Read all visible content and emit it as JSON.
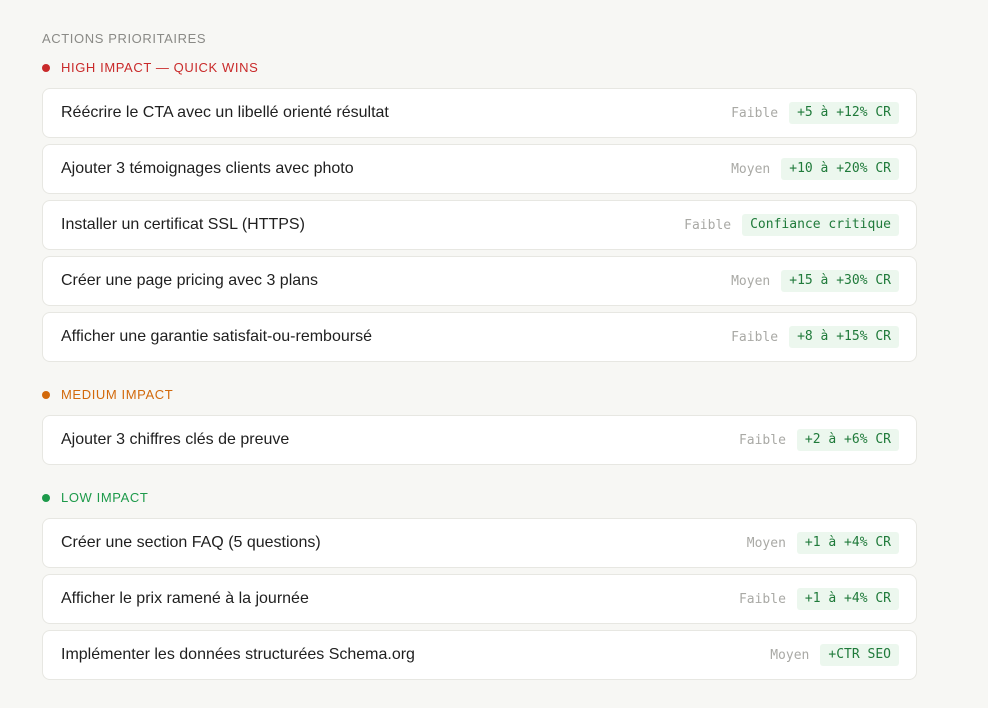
{
  "page": {
    "title": "ACTIONS PRIORITAIRES"
  },
  "colors": {
    "high": "#c92a2a",
    "medium": "#d2690b",
    "low": "#1d9a4a",
    "badge_bg": "#ecf7ee",
    "badge_text": "#1f7a3a"
  },
  "sections": [
    {
      "label": "HIGH IMPACT — QUICK WINS",
      "level": "high",
      "items": [
        {
          "title": "Réécrire le CTA avec un libellé orienté résultat",
          "effort": "Faible",
          "impact": "+5 à +12% CR"
        },
        {
          "title": "Ajouter 3 témoignages clients avec photo",
          "effort": "Moyen",
          "impact": "+10 à +20% CR"
        },
        {
          "title": "Installer un certificat SSL (HTTPS)",
          "effort": "Faible",
          "impact": "Confiance critique"
        },
        {
          "title": "Créer une page pricing avec 3 plans",
          "effort": "Moyen",
          "impact": "+15 à +30% CR"
        },
        {
          "title": "Afficher une garantie satisfait-ou-remboursé",
          "effort": "Faible",
          "impact": "+8 à +15% CR"
        }
      ]
    },
    {
      "label": "MEDIUM IMPACT",
      "level": "medium",
      "items": [
        {
          "title": "Ajouter 3 chiffres clés de preuve",
          "effort": "Faible",
          "impact": "+2 à +6% CR"
        }
      ]
    },
    {
      "label": "LOW IMPACT",
      "level": "low",
      "items": [
        {
          "title": "Créer une section FAQ (5 questions)",
          "effort": "Moyen",
          "impact": "+1 à +4% CR"
        },
        {
          "title": "Afficher le prix ramené à la journée",
          "effort": "Faible",
          "impact": "+1 à +4% CR"
        },
        {
          "title": "Implémenter les données structurées Schema.org",
          "effort": "Moyen",
          "impact": "+CTR SEO"
        }
      ]
    }
  ]
}
